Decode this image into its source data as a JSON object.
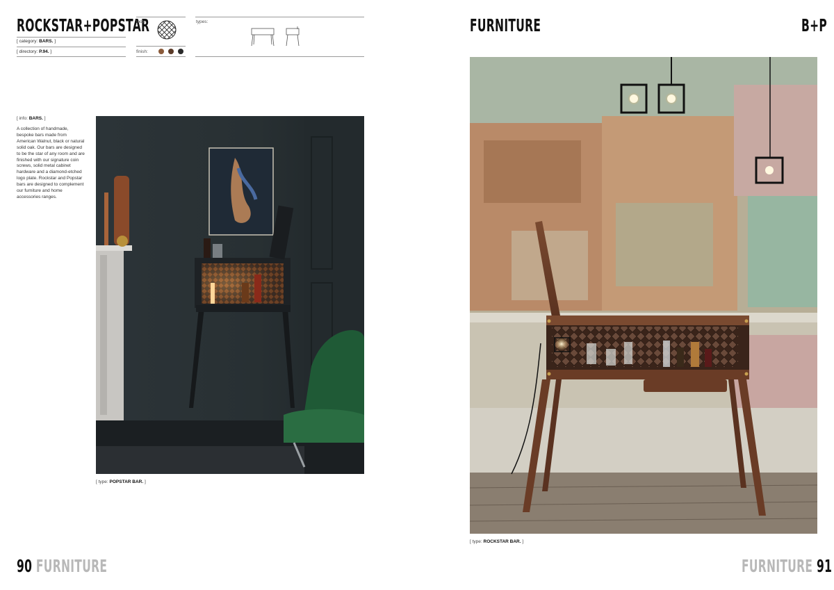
{
  "left_page": {
    "title": "ROCKSTAR+POPSTAR",
    "category_prefix": "[ category: ",
    "category_value": "BARS.",
    "category_suffix": " ]",
    "directory_prefix": "[ directory: ",
    "directory_value": "P.94.",
    "directory_suffix": " ]",
    "look_label": "look:",
    "finish_label": "finish:",
    "types_label": "types:",
    "finish_colors": [
      "#8a5a3a",
      "#5a3a28",
      "#2a2a2a"
    ],
    "info_prefix": "[ info: ",
    "info_value": "BARS.",
    "info_suffix": " ]",
    "info_text": "A collection of handmade, bespoke bars made from American Walnut, black or natural solid oak. Our bars are designed to be the star of any room and are finished with our signature coin screws, solid metal cabinet hardware and a diamond-etched logo plate. Rockstar and Popstar bars are designed to complement our furniture and home accessories ranges.",
    "caption_prefix": "[ type: ",
    "caption_value": "POPSTAR BAR.",
    "caption_suffix": " ]",
    "folio_number": "90",
    "folio_section": "FURNITURE"
  },
  "right_page": {
    "title": "FURNITURE",
    "logo": "B+P",
    "caption_prefix": "[ type: ",
    "caption_value": "ROCKSTAR BAR.",
    "caption_suffix": " ]",
    "folio_section": "FURNITURE",
    "folio_number": "91"
  }
}
